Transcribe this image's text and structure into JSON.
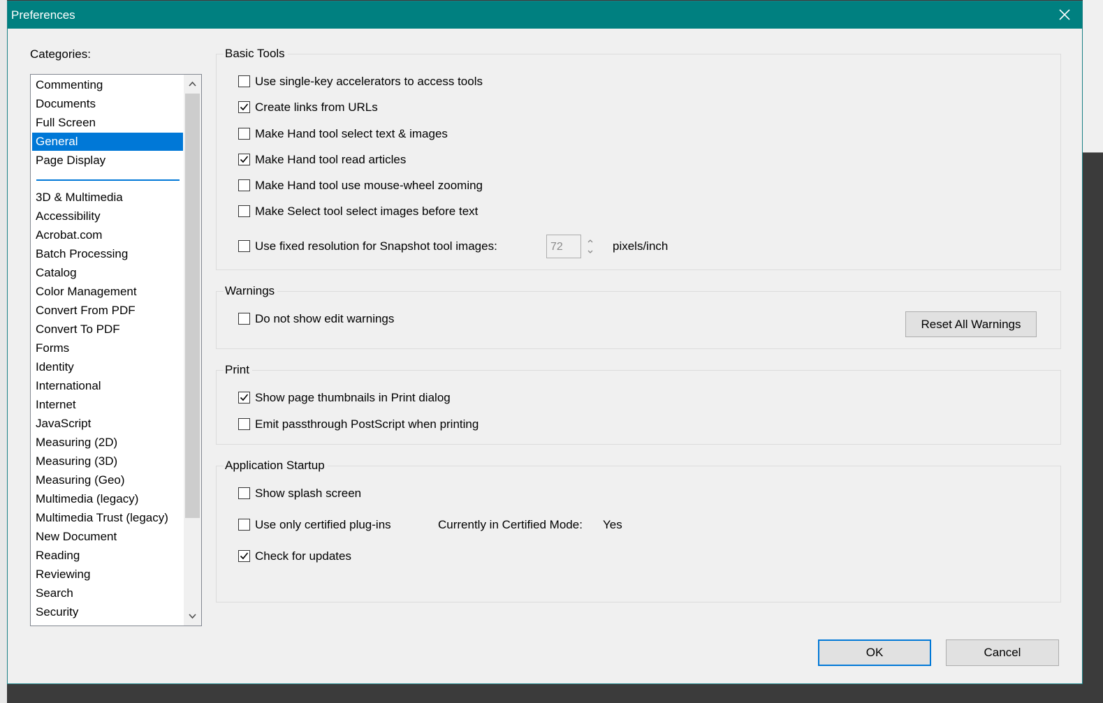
{
  "window": {
    "title": "Preferences"
  },
  "categories": {
    "label": "Categories:",
    "top_items": [
      "Commenting",
      "Documents",
      "Full Screen",
      "General",
      "Page Display"
    ],
    "selected": "General",
    "other_items": [
      "3D & Multimedia",
      "Accessibility",
      "Acrobat.com",
      "Batch Processing",
      "Catalog",
      "Color Management",
      "Convert From PDF",
      "Convert To PDF",
      "Forms",
      "Identity",
      "International",
      "Internet",
      "JavaScript",
      "Measuring (2D)",
      "Measuring (3D)",
      "Measuring (Geo)",
      "Multimedia (legacy)",
      "Multimedia Trust (legacy)",
      "New Document",
      "Reading",
      "Reviewing",
      "Search",
      "Security"
    ]
  },
  "basic_tools": {
    "title": "Basic Tools",
    "options": [
      {
        "label": "Use single-key accelerators to access tools",
        "checked": false
      },
      {
        "label": "Create links from URLs",
        "checked": true
      },
      {
        "label": "Make Hand tool select text & images",
        "checked": false
      },
      {
        "label": "Make Hand tool read articles",
        "checked": true
      },
      {
        "label": "Make Hand tool use mouse-wheel zooming",
        "checked": false
      },
      {
        "label": "Make Select tool select images before text",
        "checked": false
      },
      {
        "label": "Use fixed resolution for Snapshot tool images:",
        "checked": false
      }
    ],
    "resolution_value": "72",
    "resolution_unit": "pixels/inch"
  },
  "warnings": {
    "title": "Warnings",
    "options": [
      {
        "label": "Do not show edit warnings",
        "checked": false
      }
    ],
    "reset_button": "Reset All Warnings"
  },
  "print": {
    "title": "Print",
    "options": [
      {
        "label": "Show page thumbnails in Print dialog",
        "checked": true
      },
      {
        "label": "Emit passthrough PostScript when printing",
        "checked": false
      }
    ]
  },
  "startup": {
    "title": "Application Startup",
    "options": [
      {
        "label": "Show splash screen",
        "checked": false
      },
      {
        "label": "Use only certified plug-ins",
        "checked": false
      },
      {
        "label": "Check for updates",
        "checked": true
      }
    ],
    "certified_mode_label": "Currently in Certified Mode:",
    "certified_mode_value": "Yes"
  },
  "footer": {
    "ok": "OK",
    "cancel": "Cancel"
  },
  "colors": {
    "titlebar": "#008080",
    "selection": "#0078d7",
    "dialog_bg": "#f0f0f0"
  }
}
